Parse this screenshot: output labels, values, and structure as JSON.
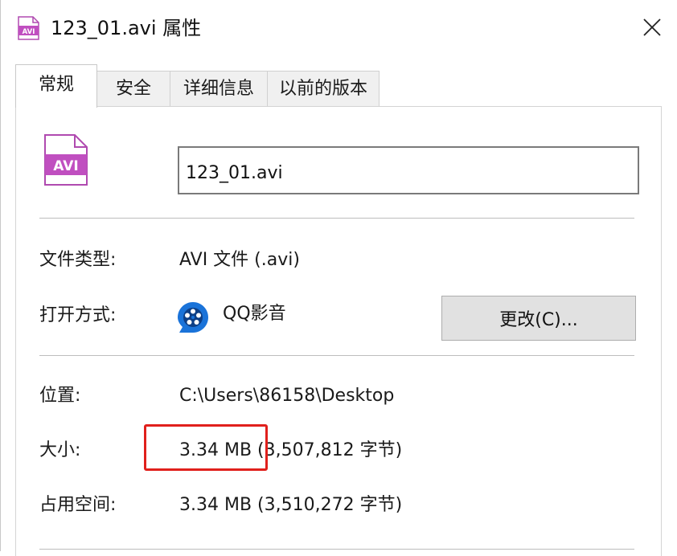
{
  "window": {
    "title": "123_01.avi 属性",
    "icon": "avi-file-icon",
    "close_icon": "close-icon"
  },
  "tabs": [
    {
      "label": "常规",
      "active": true
    },
    {
      "label": "安全",
      "active": false
    },
    {
      "label": "详细信息",
      "active": false
    },
    {
      "label": "以前的版本",
      "active": false
    }
  ],
  "general": {
    "file_icon_text": "AVI",
    "file_name": "123_01.avi",
    "file_type_label": "文件类型:",
    "file_type_value": "AVI 文件 (.avi)",
    "open_with_label": "打开方式:",
    "open_with_app": "QQ影音",
    "change_button": "更改(C)...",
    "location_label": "位置:",
    "location_value": "C:\\Users\\86158\\Desktop",
    "size_label": "大小:",
    "size_value": "3.34 MB (3,507,812 字节)",
    "size_on_disk_label": "占用空间:",
    "size_on_disk_value": "3.34 MB (3,510,272 字节)"
  },
  "annotation": {
    "highlight_color": "#e0201c"
  },
  "colors": {
    "avi_icon": "#c04fc0",
    "app_icon": "#1a73d9"
  }
}
